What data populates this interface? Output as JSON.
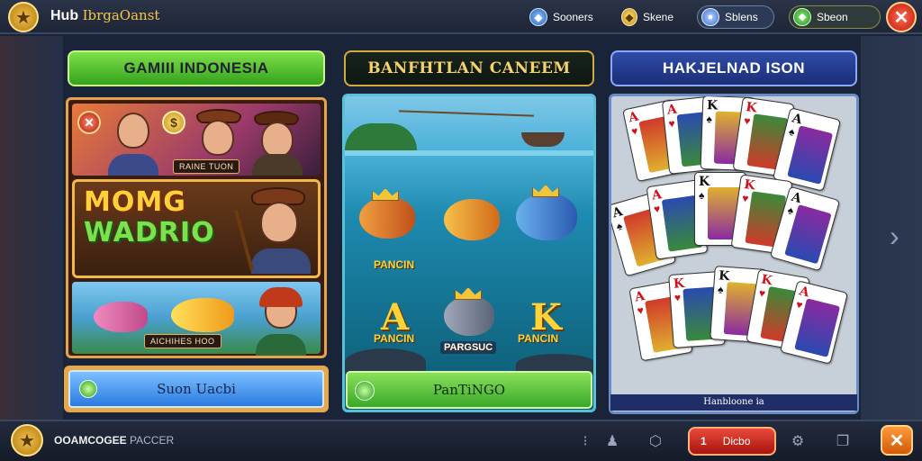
{
  "app": {
    "title": "Hub",
    "subtitle": "IbrgaOanst"
  },
  "topbar": {
    "stat1": "Sooners",
    "stat2": "Skene",
    "stat3": "Sblens",
    "stat4": "Sbeon"
  },
  "panels": [
    {
      "header": "GAMIII INDONESIA",
      "tag_top": "RAINE TUON",
      "big_title_1": "MOMG",
      "big_title_2": "WADRIO",
      "tag_bottom": "AICHIHES HOO",
      "button": "Suon Uacbi"
    },
    {
      "header": "BANFHTLAN CANEEM",
      "fish_label": "PANCIN",
      "letter_a": "A",
      "letter_a_label": "PANCIN",
      "mid_label": "PARGSUC",
      "letter_k": "K",
      "letter_k_label": "PANCIN",
      "button": "PanTiNGO"
    },
    {
      "header": "HAKJELNAD ISON",
      "footer_label": "Hanbloone ia"
    }
  ],
  "bottombar": {
    "label": "OOAMCOGEE",
    "label_dim": "PACCER",
    "red_btn_number": "1",
    "red_btn_label": "Dicbo"
  },
  "cards": [
    {
      "rank": "A",
      "suit": "♥",
      "color": "red"
    },
    {
      "rank": "A",
      "suit": "♥",
      "color": "red"
    },
    {
      "rank": "K",
      "suit": "♠",
      "color": "blk"
    },
    {
      "rank": "K",
      "suit": "♥",
      "color": "red"
    },
    {
      "rank": "A",
      "suit": "♠",
      "color": "blk"
    },
    {
      "rank": "A",
      "suit": "♠",
      "color": "blk"
    },
    {
      "rank": "A",
      "suit": "♥",
      "color": "red"
    },
    {
      "rank": "K",
      "suit": "♠",
      "color": "blk"
    },
    {
      "rank": "K",
      "suit": "♥",
      "color": "red"
    },
    {
      "rank": "A",
      "suit": "♠",
      "color": "blk"
    },
    {
      "rank": "A",
      "suit": "♥",
      "color": "red"
    },
    {
      "rank": "K",
      "suit": "♥",
      "color": "red"
    },
    {
      "rank": "K",
      "suit": "♠",
      "color": "blk"
    },
    {
      "rank": "K",
      "suit": "♥",
      "color": "red"
    },
    {
      "rank": "A",
      "suit": "♥",
      "color": "red"
    }
  ],
  "icons": {
    "logo": "star-icon",
    "close": "close-icon",
    "next": "chevron-right-icon",
    "user": "user-icon",
    "box": "box-icon",
    "gear": "gear-icon",
    "window": "window-icon"
  },
  "colors": {
    "accent_green": "#5cc832",
    "accent_gold": "#f2b84a",
    "accent_blue": "#2e4ca8",
    "danger_red": "#d0201a"
  }
}
